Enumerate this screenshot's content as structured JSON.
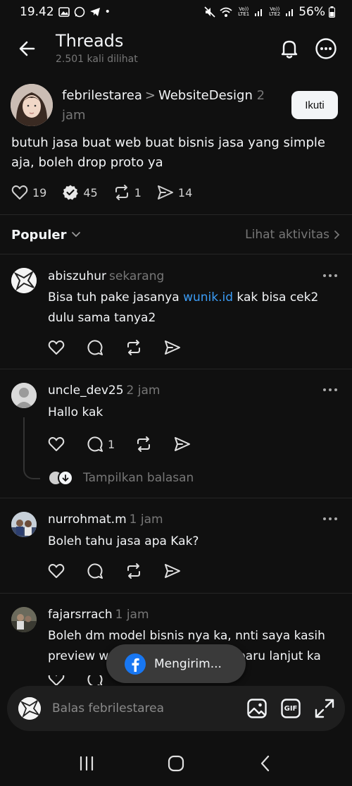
{
  "status_bar": {
    "time": "19.42",
    "battery": "56%",
    "sim1": "Vo)) LTE1",
    "sim2": "Vo)) LTE2"
  },
  "header": {
    "title": "Threads",
    "subtitle": "2.501 kali dilihat"
  },
  "post": {
    "author": "febrilestarea",
    "separator": ">",
    "community": "WebsiteDesign",
    "time": "2 jam",
    "follow_label": "Ikuti",
    "text": "butuh jasa buat web buat bisnis jasa yang simple aja, boleh drop proto ya",
    "likes": "19",
    "comments": "45",
    "reposts": "1",
    "shares": "14"
  },
  "sort": {
    "label": "Populer",
    "activity_link": "Lihat aktivitas"
  },
  "replies": [
    {
      "author": "abiszuhur",
      "time": "sekarang",
      "text_before": "Bisa tuh pake jasanya ",
      "link": "wunik.id",
      "text_after": " kak bisa cek2 dulu sama tanya2"
    },
    {
      "author": "uncle_dev25",
      "time": "2 jam",
      "text": "Hallo kak",
      "comment_count": "1",
      "show_replies": "Tampilkan balasan"
    },
    {
      "author": "nurrohmat.m",
      "time": "1 jam",
      "text": "Boleh tahu jasa apa Kak?"
    },
    {
      "author": "fajarsrrach",
      "time": "1 jam",
      "text": "Boleh dm model bisnis nya ka, nnti saya kasih preview web n free. Kalo cocok baru lanjut ka"
    }
  ],
  "toast": {
    "text": "Mengirim..."
  },
  "composer": {
    "placeholder": "Balas febrilestarea",
    "gif_label": "GIF"
  },
  "colors": {
    "background": "#101010",
    "link": "#3b9cf5",
    "muted": "#777777",
    "facebook": "#1877f2"
  }
}
